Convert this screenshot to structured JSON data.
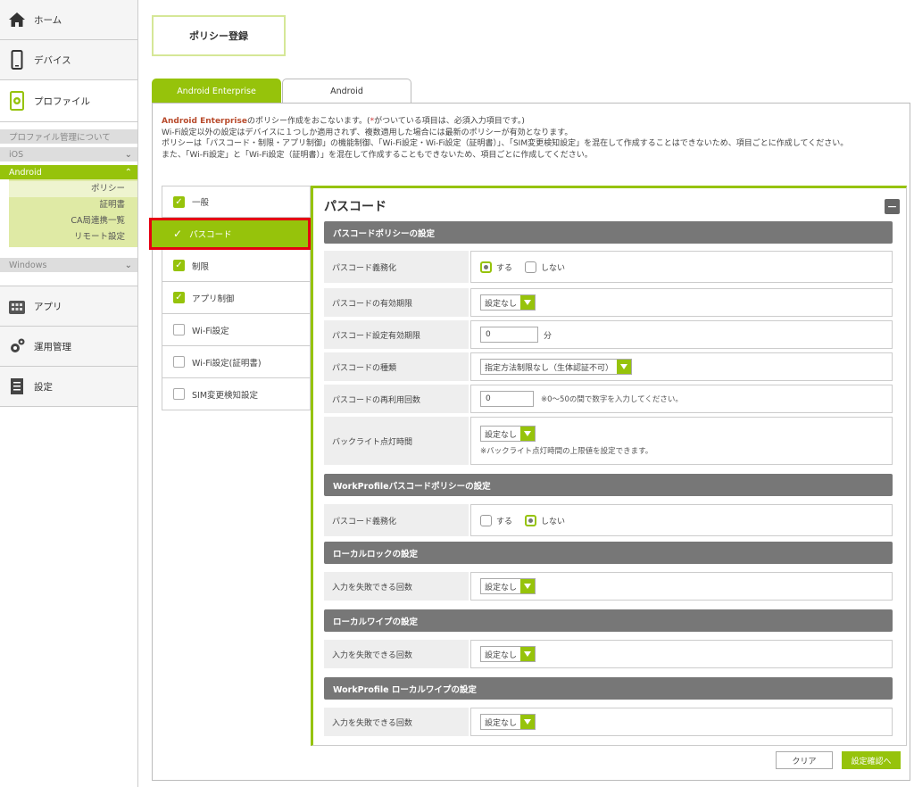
{
  "sidebar": {
    "home": "ホーム",
    "device": "デバイス",
    "profile": "プロファイル",
    "about": "プロファイル管理について",
    "ios": "iOS",
    "android": "Android",
    "android_items": [
      "ポリシー",
      "証明書",
      "CA局連携一覧",
      "リモート設定"
    ],
    "windows": "Windows",
    "app": "アプリ",
    "ops": "運用管理",
    "settings": "設定"
  },
  "page_title": "ポリシー登録",
  "tabs": [
    "Android Enterprise",
    "Android"
  ],
  "intro": {
    "ae": "Android Enterprise",
    "line1_rest": "のポリシー作成をおこないます。(",
    "req_mark": "*",
    "line1_end": "がついている項目は、必須入力項目です。)",
    "line2": "Wi-Fi設定以外の設定はデバイスに１つしか適用されず、複数適用した場合には最新のポリシーが有効となります。",
    "line3": "ポリシーは「パスコード・制限・アプリ制御」の機能制御、「Wi-Fi設定・Wi-Fi設定（証明書）」、「SIM変更検知設定」を混在して作成することはできないため、項目ごとに作成してください。",
    "line4": "また、「Wi-Fi設定」と「Wi-Fi設定（証明書）」を混在して作成することもできないため、項目ごとに作成してください。"
  },
  "menu": [
    {
      "label": "一般",
      "checked": true
    },
    {
      "label": "パスコード",
      "checked": true
    },
    {
      "label": "制限",
      "checked": true
    },
    {
      "label": "アプリ制御",
      "checked": true
    },
    {
      "label": "Wi-Fi設定",
      "checked": false
    },
    {
      "label": "Wi-Fi設定(証明書)",
      "checked": false
    },
    {
      "label": "SIM変更検知設定",
      "checked": false
    }
  ],
  "panel_title": "パスコード",
  "sections": {
    "passcode_policy": "パスコードポリシーの設定",
    "work_passcode": "WorkProfileパスコードポリシーの設定",
    "local_lock": "ローカルロックの設定",
    "local_wipe": "ローカルワイプの設定",
    "work_wipe": "WorkProfile ローカルワイプの設定"
  },
  "rows": {
    "required": "パスコード義務化",
    "expiry": "パスコードの有効期限",
    "setting_expiry": "パスコード設定有効期限",
    "type": "パスコードの種類",
    "reuse": "パスコードの再利用回数",
    "backlight": "バックライト点灯時間",
    "fail_count": "入力を失敗できる回数"
  },
  "values": {
    "yes": "する",
    "no": "しない",
    "none": "設定なし",
    "zero": "0",
    "minute": "分",
    "type_value": "指定方法制限なし（生体認証不可）",
    "reuse_note": "※0～50の間で数字を入力してください。",
    "backlight_note": "※バックライト点灯時間の上限値を設定できます。",
    "none_short": "設定なし"
  },
  "buttons": {
    "clear": "クリア",
    "confirm": "設定確認へ"
  }
}
